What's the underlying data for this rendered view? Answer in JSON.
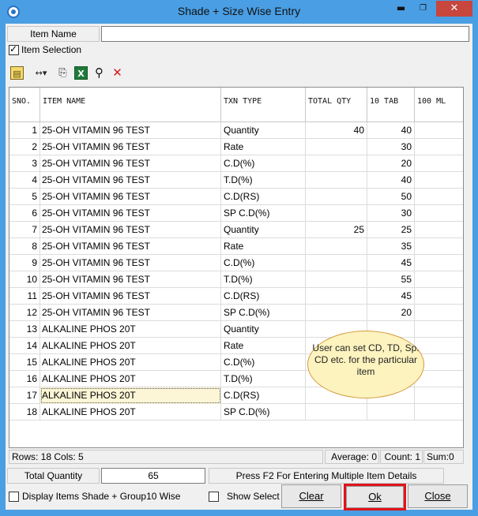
{
  "window": {
    "title": "Shade + Size Wise Entry",
    "min_label": "▬",
    "max_label": "❐",
    "close_label": "✕"
  },
  "item_name": {
    "label": "Item Name",
    "value": ""
  },
  "item_selection": {
    "label": "Item Selection",
    "checked": true
  },
  "toolbar": {
    "icons": [
      "save-icon",
      "columns-icon",
      "copy-icon",
      "excel-icon",
      "find-icon",
      "delete-icon"
    ],
    "glyphs": {
      "save": "▤",
      "columns": "↔▾",
      "copy": "⎘",
      "excel": "X",
      "find": "⚲",
      "delete": "✕"
    }
  },
  "grid": {
    "columns": [
      "SNO.",
      "ITEM NAME",
      "TXN TYPE",
      "TOTAL QTY",
      "10 TAB",
      "100 ML"
    ],
    "rows": [
      {
        "sno": "1",
        "name": "25-OH VITAMIN 96 TEST",
        "txn": "Quantity",
        "total": "40",
        "tab": "40",
        "ml": ""
      },
      {
        "sno": "2",
        "name": "25-OH VITAMIN 96 TEST",
        "txn": "Rate",
        "total": "",
        "tab": "30",
        "ml": ""
      },
      {
        "sno": "3",
        "name": "25-OH VITAMIN 96 TEST",
        "txn": "C.D(%)",
        "total": "",
        "tab": "20",
        "ml": ""
      },
      {
        "sno": "4",
        "name": "25-OH VITAMIN 96 TEST",
        "txn": "T.D(%)",
        "total": "",
        "tab": "40",
        "ml": ""
      },
      {
        "sno": "5",
        "name": "25-OH VITAMIN 96 TEST",
        "txn": "C.D(RS)",
        "total": "",
        "tab": "50",
        "ml": ""
      },
      {
        "sno": "6",
        "name": "25-OH VITAMIN 96 TEST",
        "txn": "SP C.D(%)",
        "total": "",
        "tab": "30",
        "ml": ""
      },
      {
        "sno": "7",
        "name": "25-OH VITAMIN 96 TEST",
        "txn": "Quantity",
        "total": "25",
        "tab": "25",
        "ml": ""
      },
      {
        "sno": "8",
        "name": "25-OH VITAMIN 96 TEST",
        "txn": "Rate",
        "total": "",
        "tab": "35",
        "ml": ""
      },
      {
        "sno": "9",
        "name": "25-OH VITAMIN 96 TEST",
        "txn": "C.D(%)",
        "total": "",
        "tab": "45",
        "ml": ""
      },
      {
        "sno": "10",
        "name": "25-OH VITAMIN 96 TEST",
        "txn": "T.D(%)",
        "total": "",
        "tab": "55",
        "ml": ""
      },
      {
        "sno": "11",
        "name": "25-OH VITAMIN 96 TEST",
        "txn": "C.D(RS)",
        "total": "",
        "tab": "45",
        "ml": ""
      },
      {
        "sno": "12",
        "name": "25-OH VITAMIN 96 TEST",
        "txn": "SP C.D(%)",
        "total": "",
        "tab": "20",
        "ml": ""
      },
      {
        "sno": "13",
        "name": "ALKALINE PHOS 20T",
        "txn": "Quantity",
        "total": "",
        "tab": "",
        "ml": ""
      },
      {
        "sno": "14",
        "name": "ALKALINE PHOS 20T",
        "txn": "Rate",
        "total": "",
        "tab": "",
        "ml": ""
      },
      {
        "sno": "15",
        "name": "ALKALINE PHOS 20T",
        "txn": "C.D(%)",
        "total": "",
        "tab": "",
        "ml": ""
      },
      {
        "sno": "16",
        "name": "ALKALINE PHOS 20T",
        "txn": "T.D(%)",
        "total": "",
        "tab": "",
        "ml": ""
      },
      {
        "sno": "17",
        "name": "ALKALINE PHOS 20T",
        "txn": "C.D(RS)",
        "total": "",
        "tab": "",
        "ml": ""
      },
      {
        "sno": "18",
        "name": "ALKALINE PHOS 20T",
        "txn": "SP C.D(%)",
        "total": "",
        "tab": "",
        "ml": ""
      }
    ],
    "selected_row": 17
  },
  "callout": {
    "text": "User can set CD, TD, Sp. CD etc. for the particular item"
  },
  "status": {
    "rows_cols": "Rows: 18  Cols: 5",
    "average": "Average: 0",
    "count": "Count: 1",
    "sum": "Sum:0"
  },
  "total_quantity": {
    "label": "Total Quantity",
    "value": "65"
  },
  "hint": "Press F2 For Entering Multiple Item Details",
  "options": {
    "display_shade": {
      "label": "Display Items Shade + Group10 Wise",
      "checked": false
    },
    "show_select": {
      "label": "Show Select",
      "checked": false
    }
  },
  "buttons": {
    "clear": "Clear",
    "ok": "Ok",
    "close": "Close"
  }
}
